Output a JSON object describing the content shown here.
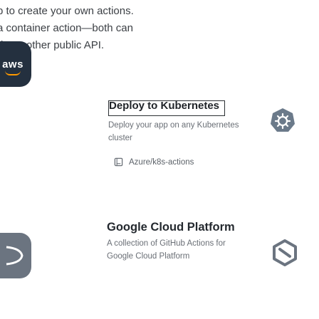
{
  "intro": {
    "lines": [
      "p to create your own actions.",
      "a container action—both can",
      "d any other public API."
    ]
  },
  "cards": [
    {
      "logo_text": "aws",
      "title": "Deploy to Kubernetes",
      "desc_line1": "Deploy your app on any Kubernetes",
      "desc_line2": "cluster",
      "repo": "Azure/k8s-actions",
      "icon": "kubernetes-helm-icon"
    },
    {
      "title": "Google Cloud Platform",
      "desc_line1": "A collection of GitHub Actions for",
      "desc_line2": "Google Cloud Platform",
      "icon": "gcp-icon"
    }
  ],
  "colors": {
    "aws_dark": "#24303f",
    "aws_orange": "#ff9900",
    "gcp_grey": "#6b7480",
    "k8s_badge": "#6b7a8a"
  }
}
